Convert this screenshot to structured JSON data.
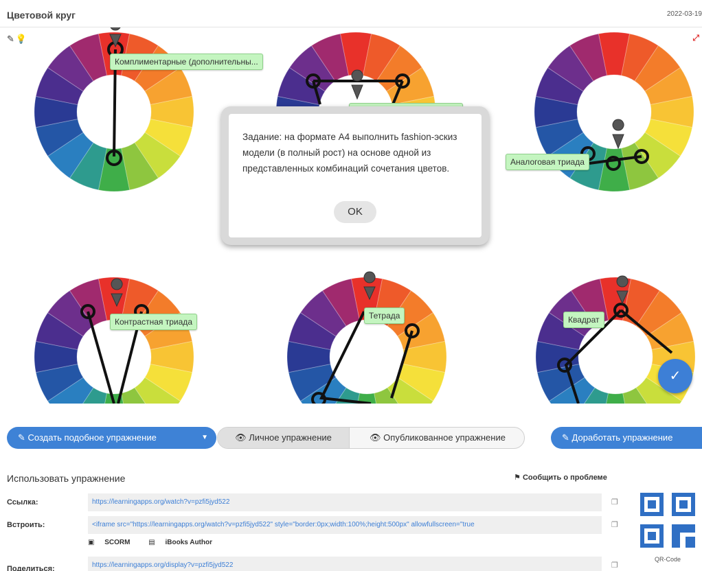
{
  "header": {
    "title": "Цветовой круг",
    "date": "2022-03-19"
  },
  "app": {
    "labels": {
      "complementary": "Комплиментарные (дополнительны...",
      "analog_triad": "Аналоговая триада",
      "contrast_triad": "Контрастная триада",
      "tetrad": "Тетрада",
      "square": "Квадрат"
    },
    "dialog": {
      "text": "Задание: на формате А4 выполнить fashion-эскиз модели (в полный рост) на основе одной из представленных комбинаций сочетания цветов.",
      "ok_label": "OK"
    },
    "wheel_colors": [
      "#e8312a",
      "#ee5a2a",
      "#f37c2a",
      "#f7a230",
      "#f8c434",
      "#f5e03a",
      "#c9de3c",
      "#8ec63f",
      "#3fae49",
      "#2e9b8e",
      "#2a7fc0",
      "#2456a6",
      "#2a3a94",
      "#4b2e8e",
      "#6d2f8c",
      "#a02a6e"
    ]
  },
  "toolbar": {
    "create_label": "Создать подобное упражнение",
    "private_label": "Личное упражнение",
    "published_label": "Опубликованное упражнение",
    "improve_label": "Доработать упражнение"
  },
  "use": {
    "title": "Использовать упражнение",
    "report_label": "Сообщить о проблеме",
    "link_label": "Ссылка:",
    "link_value": "https://learningapps.org/watch?v=pzfi5jyd522",
    "embed_label": "Встроить:",
    "embed_value": "<iframe src=\"https://learningapps.org/watch?v=pzfi5jyd522\" style=\"border:0px;width:100%;height:500px\" allowfullscreen=\"true",
    "scorm_label": "SCORM",
    "ibooks_label": "iBooks Author",
    "share_label": "Поделиться:",
    "share_value": "https://learningapps.org/display?v=pzfi5jyd522",
    "qr_label": "QR-Code"
  }
}
